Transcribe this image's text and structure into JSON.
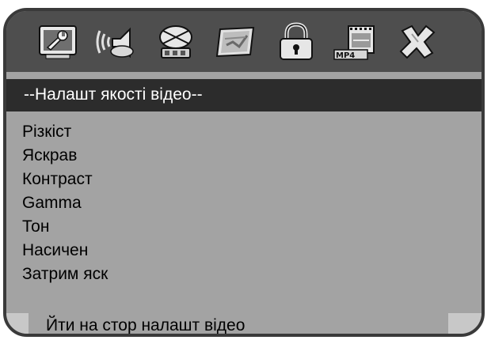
{
  "toolbar": {
    "icons": [
      "general-setup-icon",
      "audio-setup-icon",
      "speaker-setup-icon",
      "video-setup-icon",
      "password-lock-icon",
      "mp4-setup-icon",
      "exit-icon"
    ]
  },
  "title": "--Налашт якості відео--",
  "menu": {
    "items": [
      {
        "label": "Різкіст"
      },
      {
        "label": "Яскрав"
      },
      {
        "label": "Контраст"
      },
      {
        "label": "Gamma"
      },
      {
        "label": "Тон"
      },
      {
        "label": "Насичен"
      },
      {
        "label": "Затрим яск"
      }
    ]
  },
  "footer": {
    "hint": "Йти на стор налашт відео"
  },
  "colors": {
    "panel": "#a3a3a3",
    "toolbar": "#4e4e4e",
    "title_bar": "#2c2c2c",
    "border": "#3a3a3a"
  }
}
